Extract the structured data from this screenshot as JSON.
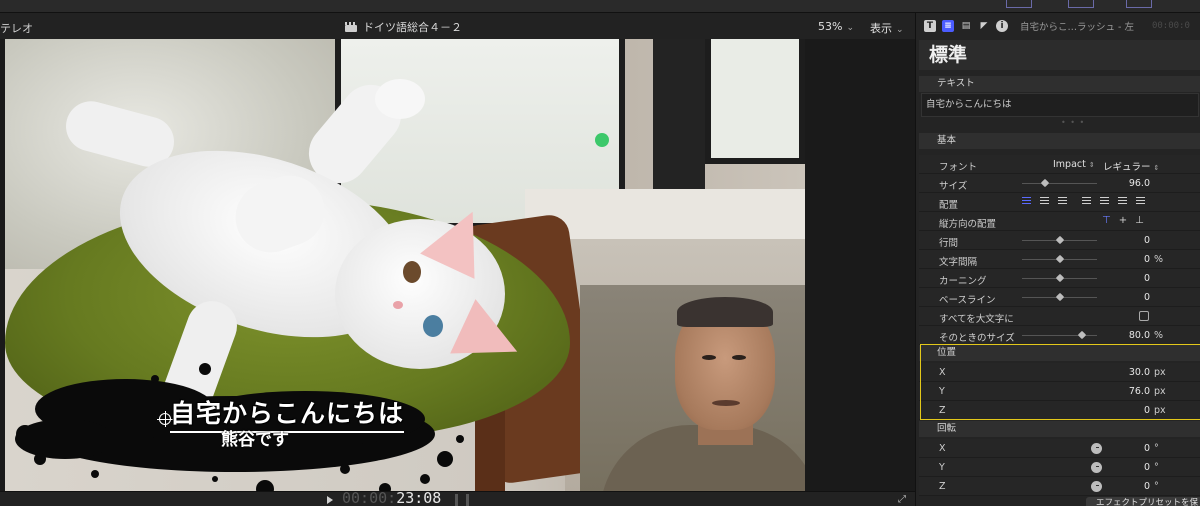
{
  "viewer": {
    "left_label": "テレオ",
    "project_title": "ドイツ語総合４－２",
    "zoom": "53%",
    "view_menu": "表示"
  },
  "overlay": {
    "title_line1": "自宅からこんにちは",
    "title_line2": "熊谷です"
  },
  "transport": {
    "timecode_dim": "00:00:",
    "timecode": "23:08"
  },
  "inspector": {
    "header_title": "自宅からこ…ラッシュ - 左",
    "header_tc": "00:00:0",
    "preset": "標準",
    "text_section": "テキスト",
    "text_value": "自宅からこんにちは",
    "basic_section": "基本",
    "rows": {
      "font_label": "フォント",
      "font_value": "Impact",
      "font_style": "レギュラー",
      "size_label": "サイズ",
      "size_value": "96.0",
      "size_level": 0.3,
      "alignment_label": "配置",
      "valign_label": "縦方向の配置",
      "line_spacing_label": "行間",
      "line_spacing_value": "0",
      "line_spacing_level": 0.5,
      "tracking_label": "文字間隔",
      "tracking_value": "0",
      "tracking_unit": "%",
      "tracking_level": 0.5,
      "kerning_label": "カーニング",
      "kerning_value": "0",
      "kerning_level": 0.5,
      "baseline_label": "ベースライン",
      "baseline_value": "0",
      "baseline_level": 0.5,
      "all_caps_label": "すべてを大文字に",
      "all_caps_size_label": "そのときのサイズ",
      "all_caps_size_value": "80.0",
      "all_caps_size_unit": "%",
      "all_caps_size_level": 0.8
    },
    "position": {
      "section": "位置",
      "x_label": "X",
      "x_value": "30.0",
      "x_unit": "px",
      "y_label": "Y",
      "y_value": "76.0",
      "y_unit": "px",
      "z_label": "Z",
      "z_value": "0",
      "z_unit": "px"
    },
    "rotation": {
      "section": "回転",
      "x_label": "X",
      "x_value": "0",
      "x_unit": "°",
      "y_label": "Y",
      "y_value": "0",
      "y_unit": "°",
      "z_label": "Z",
      "z_value": "0",
      "z_unit": "°"
    },
    "save_preset_button": "エフェクトプリセットを保存"
  },
  "colors": {
    "accent": "#4b5cff",
    "position_highlight": "#e3c81a",
    "panel_bg": "#242424"
  }
}
